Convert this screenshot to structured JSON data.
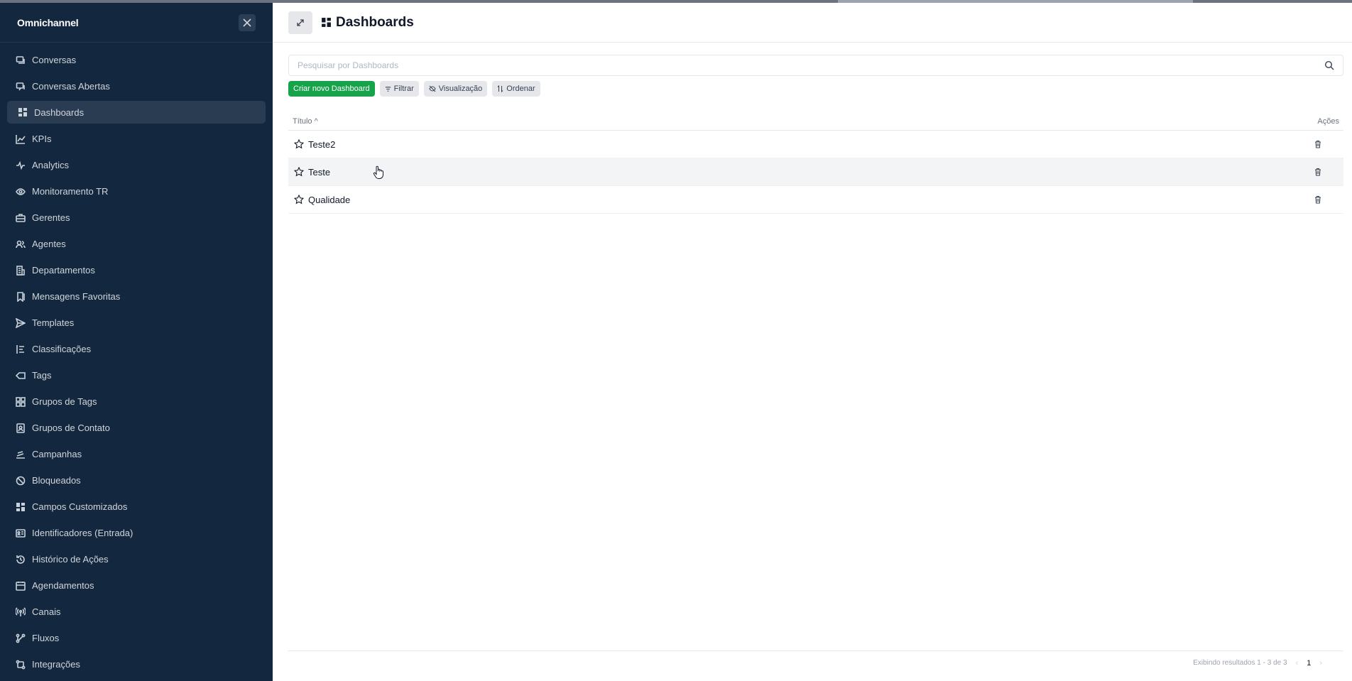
{
  "sidebar": {
    "brand": "Omnichannel",
    "items": [
      {
        "label": "Conversas",
        "icon": "chat-icon"
      },
      {
        "label": "Conversas Abertas",
        "icon": "chats-icon"
      },
      {
        "label": "Dashboards",
        "icon": "grid-icon",
        "active": true
      },
      {
        "label": "KPIs",
        "icon": "line-chart-icon"
      },
      {
        "label": "Analytics",
        "icon": "activity-icon"
      },
      {
        "label": "Monitoramento TR",
        "icon": "eye-icon"
      },
      {
        "label": "Gerentes",
        "icon": "briefcase-icon"
      },
      {
        "label": "Agentes",
        "icon": "users-icon"
      },
      {
        "label": "Departamentos",
        "icon": "building-icon"
      },
      {
        "label": "Mensagens Favoritas",
        "icon": "bookmark-icon"
      },
      {
        "label": "Templates",
        "icon": "send-icon"
      },
      {
        "label": "Classificações",
        "icon": "list-icon"
      },
      {
        "label": "Tags",
        "icon": "tag-icon"
      },
      {
        "label": "Grupos de Tags",
        "icon": "grid-outline-icon"
      },
      {
        "label": "Grupos de Contato",
        "icon": "contact-book-icon"
      },
      {
        "label": "Campanhas",
        "icon": "campaign-icon"
      },
      {
        "label": "Bloqueados",
        "icon": "ban-icon"
      },
      {
        "label": "Campos Customizados",
        "icon": "grid-icon"
      },
      {
        "label": "Identificadores (Entrada)",
        "icon": "id-card-icon"
      },
      {
        "label": "Histórico de Ações",
        "icon": "history-icon"
      },
      {
        "label": "Agendamentos",
        "icon": "calendar-icon"
      },
      {
        "label": "Canais",
        "icon": "antenna-icon"
      },
      {
        "label": "Fluxos",
        "icon": "flow-icon"
      },
      {
        "label": "Integrações",
        "icon": "integration-icon"
      }
    ]
  },
  "header": {
    "title": "Dashboards"
  },
  "search": {
    "placeholder": "Pesquisar por Dashboards",
    "value": ""
  },
  "toolbar": {
    "create_label": "Criar novo Dashboard",
    "filter_label": "Filtrar",
    "view_label": "Visualização",
    "sort_label": "Ordenar"
  },
  "table": {
    "col_title": "Título",
    "sort_indicator": "^",
    "col_actions": "Ações",
    "rows": [
      {
        "title": "Teste2"
      },
      {
        "title": "Teste"
      },
      {
        "title": "Qualidade"
      }
    ]
  },
  "footer": {
    "results_text": "Exibindo resultados 1 - 3 de 3",
    "prev": "‹",
    "current_page": "1",
    "next": "›"
  },
  "colors": {
    "sidebar_bg": "#13283f",
    "primary": "#16a34a",
    "active_item_bg": "#2a3c51"
  }
}
